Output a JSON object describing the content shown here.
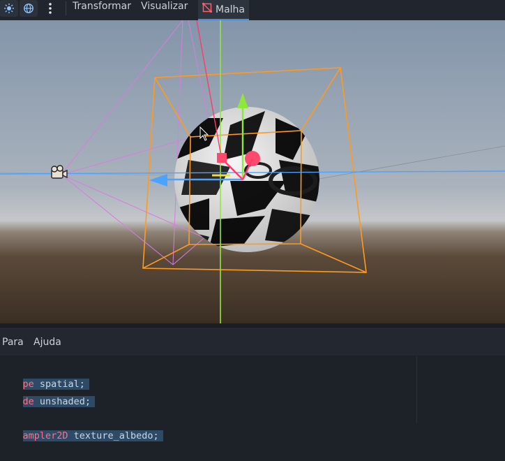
{
  "toolbar": {
    "icons": [
      "sun-icon",
      "globe-icon",
      "more-vertical-icon"
    ],
    "menus": [
      "Transformar",
      "Visualizar"
    ],
    "active_tab": {
      "label": "Malha",
      "icon": "mesh-icon"
    }
  },
  "viewport": {
    "description_icons": [
      "camera-gizmo-icon",
      "mouse-cursor-icon"
    ],
    "colors": {
      "selection_box": "#ff9a1f",
      "x_axis": "#ff3a6a",
      "y_axis": "#8ee83a",
      "z_axis": "#4aa3ff",
      "frustum": "#d87ce0"
    }
  },
  "bottom_panel": {
    "menus": [
      "Para",
      "Ajuda"
    ]
  },
  "code": {
    "lines": [
      {
        "kw": "pe",
        "rest": " spatial;"
      },
      {
        "kw": "de",
        "rest": " unshaded;"
      },
      {
        "kw": "",
        "rest": ""
      },
      {
        "kw": "ampler2D",
        "rest": " texture_albedo;"
      }
    ]
  }
}
